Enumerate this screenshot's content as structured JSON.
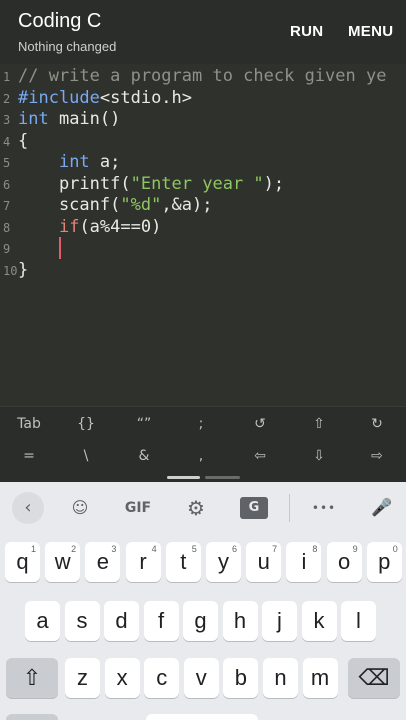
{
  "app": {
    "title": "Coding C",
    "subtitle": "Nothing changed",
    "run_label": "RUN",
    "menu_label": "MENU"
  },
  "editor": {
    "lines": [
      {
        "num": "1",
        "segments": [
          {
            "t": "// write a program to check given ye",
            "c": "cm"
          }
        ]
      },
      {
        "num": "2",
        "segments": [
          {
            "t": "#include",
            "c": "kw"
          },
          {
            "t": "<stdio.h>",
            "c": ""
          }
        ]
      },
      {
        "num": "3",
        "segments": [
          {
            "t": "int",
            "c": "ty"
          },
          {
            "t": " main()",
            "c": ""
          }
        ]
      },
      {
        "num": "4",
        "segments": [
          {
            "t": "{",
            "c": ""
          }
        ]
      },
      {
        "num": "5",
        "segments": [
          {
            "t": "    ",
            "c": ""
          },
          {
            "t": "int",
            "c": "ty"
          },
          {
            "t": " a;",
            "c": ""
          }
        ]
      },
      {
        "num": "6",
        "segments": [
          {
            "t": "    printf(",
            "c": ""
          },
          {
            "t": "\"Enter year \"",
            "c": "str"
          },
          {
            "t": ");",
            "c": ""
          }
        ]
      },
      {
        "num": "7",
        "segments": [
          {
            "t": "    scanf(",
            "c": ""
          },
          {
            "t": "\"%d\"",
            "c": "str"
          },
          {
            "t": ",&a);",
            "c": ""
          }
        ]
      },
      {
        "num": "8",
        "segments": [
          {
            "t": "    ",
            "c": ""
          },
          {
            "t": "if",
            "c": "ctl"
          },
          {
            "t": "(a%4==0)",
            "c": ""
          }
        ]
      },
      {
        "num": "9",
        "segments": [
          {
            "t": "",
            "c": ""
          }
        ]
      },
      {
        "num": "10",
        "segments": [
          {
            "t": "}",
            "c": ""
          }
        ]
      }
    ]
  },
  "extra_keys": {
    "row1": [
      "Tab",
      "{}",
      "“”",
      ";",
      "↺",
      "⇧",
      "↻"
    ],
    "row2": [
      "=",
      "\\",
      "&",
      ",",
      "⇦",
      "⇩",
      "⇨"
    ]
  },
  "keyboard": {
    "toolbar": {
      "back": "‹",
      "sticker": "☺",
      "gif": "GIF",
      "settings": "⚙",
      "translate": "G",
      "more": "•••",
      "mic": "🎤"
    },
    "row1": [
      {
        "k": "q",
        "h": "1"
      },
      {
        "k": "w",
        "h": "2"
      },
      {
        "k": "e",
        "h": "3"
      },
      {
        "k": "r",
        "h": "4"
      },
      {
        "k": "t",
        "h": "5"
      },
      {
        "k": "y",
        "h": "6"
      },
      {
        "k": "u",
        "h": "7"
      },
      {
        "k": "i",
        "h": "8"
      },
      {
        "k": "o",
        "h": "9"
      },
      {
        "k": "p",
        "h": "0"
      }
    ],
    "row2": [
      "a",
      "s",
      "d",
      "f",
      "g",
      "h",
      "j",
      "k",
      "l"
    ],
    "row3": [
      "z",
      "x",
      "c",
      "v",
      "b",
      "n",
      "m"
    ],
    "shift": "⇧",
    "backspace": "⌫"
  }
}
